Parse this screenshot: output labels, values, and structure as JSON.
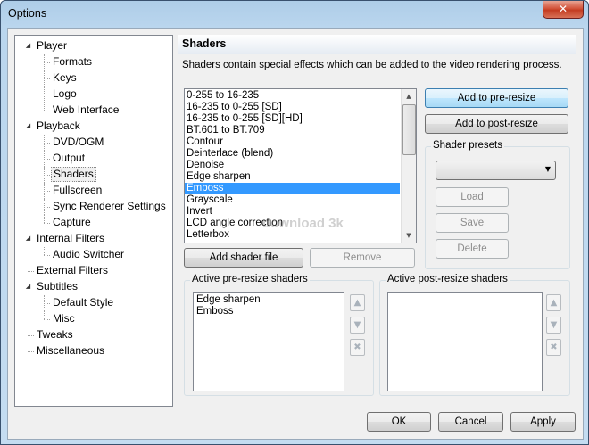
{
  "window": {
    "title": "Options",
    "close_glyph": "✕"
  },
  "tree": {
    "items": [
      {
        "label": "Player",
        "level": 0,
        "expander": "◢"
      },
      {
        "label": "Formats",
        "level": 1
      },
      {
        "label": "Keys",
        "level": 1
      },
      {
        "label": "Logo",
        "level": 1
      },
      {
        "label": "Web Interface",
        "level": 1
      },
      {
        "label": "Playback",
        "level": 0,
        "expander": "◢"
      },
      {
        "label": "DVD/OGM",
        "level": 1
      },
      {
        "label": "Output",
        "level": 1
      },
      {
        "label": "Shaders",
        "level": 1,
        "selected": true
      },
      {
        "label": "Fullscreen",
        "level": 1
      },
      {
        "label": "Sync Renderer Settings",
        "level": 1
      },
      {
        "label": "Capture",
        "level": 1
      },
      {
        "label": "Internal Filters",
        "level": 0,
        "expander": "◢"
      },
      {
        "label": "Audio Switcher",
        "level": 1
      },
      {
        "label": "External Filters",
        "level": 0
      },
      {
        "label": "Subtitles",
        "level": 0,
        "expander": "◢"
      },
      {
        "label": "Default Style",
        "level": 1
      },
      {
        "label": "Misc",
        "level": 1
      },
      {
        "label": "Tweaks",
        "level": 0
      },
      {
        "label": "Miscellaneous",
        "level": 0
      }
    ]
  },
  "page": {
    "title": "Shaders",
    "description": "Shaders contain special effects which can be added to the video rendering process."
  },
  "shader_list": {
    "items": [
      "0-255 to 16-235",
      "16-235 to 0-255 [SD]",
      "16-235 to 0-255 [SD][HD]",
      "BT.601 to BT.709",
      "Contour",
      "Deinterlace (blend)",
      "Denoise",
      "Edge sharpen",
      "Emboss",
      "Grayscale",
      "Invert",
      "LCD angle correction",
      "Letterbox"
    ],
    "selected": "Emboss"
  },
  "buttons": {
    "add_pre_resize": "Add to pre-resize",
    "add_post_resize": "Add to post-resize",
    "add_shader_file": "Add shader file",
    "remove": "Remove",
    "load": "Load",
    "save": "Save",
    "delete": "Delete",
    "ok": "OK",
    "cancel": "Cancel",
    "apply": "Apply"
  },
  "presets": {
    "label": "Shader presets",
    "value": ""
  },
  "pre_resize": {
    "label": "Active pre-resize shaders",
    "items": [
      "Edge sharpen",
      "Emboss"
    ]
  },
  "post_resize": {
    "label": "Active post-resize shaders",
    "items": []
  },
  "icons": {
    "up": "▲",
    "down": "▼",
    "remove": "✖",
    "expander": "◢",
    "scroll_up": "▲",
    "scroll_down": "▼",
    "combo_arrow": "▼"
  },
  "watermark": "download 3k"
}
